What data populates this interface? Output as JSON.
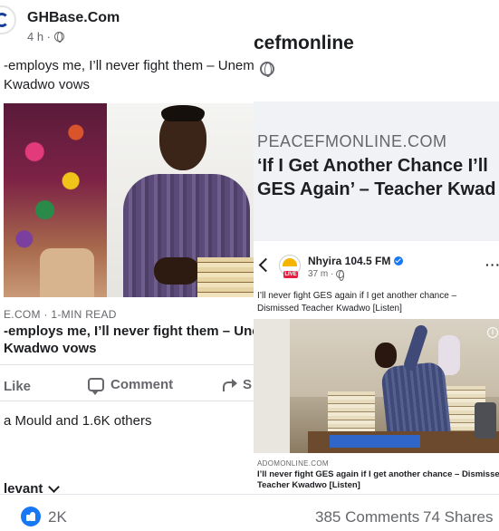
{
  "left_post": {
    "page_name": "GHBase.Com",
    "time": "4 h ·",
    "caption_lines": [
      "-employs me, I’ll never fight them – Unem",
      "Kwadwo vows"
    ],
    "link_domain": "E.COM · 1-MIN READ",
    "link_title_lines": [
      "-employs me, I’ll never fight them – Unemp",
      "Kwadwo vows"
    ],
    "actions": {
      "like": "Like",
      "comment": "Comment",
      "share": "S"
    },
    "reactions_text": "a Mould and 1.6K others",
    "sort_label": "levant"
  },
  "right_post": {
    "page_name": "cefmonline",
    "link_domain": "PEACEFMONLINE.COM",
    "link_title_lines": [
      "‘If I Get Another Chance I’ll",
      "GES Again’ – Teacher Kwad"
    ]
  },
  "nhyira_post": {
    "page_name": "Nhyira 104.5 FM",
    "live_badge": "LIVE",
    "time": "37 m ·",
    "more": "···",
    "caption_lines": [
      "I’ll never fight GES again if I get another chance –",
      "Dismissed Teacher Kwadwo [Listen]"
    ],
    "info_icon": "i",
    "link_domain": "ADOMONLINE.COM",
    "link_title_lines": [
      "I’ll never fight GES again if I get another chance – Dismissed",
      "Teacher Kwadwo [Listen]"
    ]
  },
  "bottom_bar": {
    "reaction_count": "2K",
    "comments": "385 Comments",
    "shares": "74 Shares"
  },
  "colors": {
    "facebook_blue": "#1877f2",
    "secondary_text": "#65676b",
    "link_bg": "#f0f2f5"
  },
  "icons": [
    "globe-icon",
    "comment-icon",
    "share-icon",
    "back-arrow-icon",
    "verified-badge-icon",
    "more-options-icon",
    "like-reaction-icon",
    "chevron-down-icon",
    "info-icon"
  ]
}
